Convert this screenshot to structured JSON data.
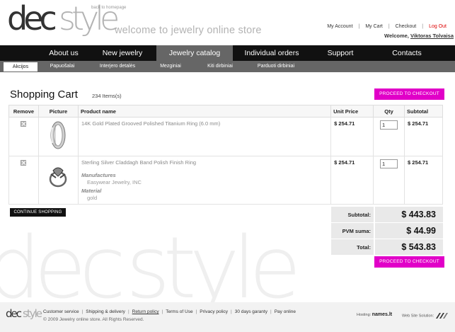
{
  "header": {
    "logo_dec": "dec",
    "logo_style": "style",
    "back_link": "back to homepage",
    "banner": "welcome to jewelry online store",
    "links": {
      "account": "My Account",
      "cart": "My Cart",
      "checkout": "Checkout",
      "logout": "Log Out"
    },
    "welcome_prefix": "Welcome,",
    "username": "Viktoras Tolvaisa"
  },
  "mainnav": [
    {
      "label": "About us",
      "active": false
    },
    {
      "label": "New jewelry",
      "active": false
    },
    {
      "label": "Jewelry catalog",
      "active": true
    },
    {
      "label": "Individual orders",
      "active": false
    },
    {
      "label": "Support",
      "active": false
    },
    {
      "label": "Contacts",
      "active": false
    }
  ],
  "subnav": [
    {
      "label": "Akcijos",
      "active": true
    },
    {
      "label": "Papuošalai",
      "active": false
    },
    {
      "label": "Interjero detalės",
      "active": false
    },
    {
      "label": "Mezginiai",
      "active": false
    },
    {
      "label": "Kiti dirbiniai",
      "active": false
    },
    {
      "label": "Parduoti dirbiniai",
      "active": false
    }
  ],
  "cart": {
    "title": "Shopping Cart",
    "items_count": "234 Items(s)",
    "checkout_label": "PROCEED TO CHECKOUT",
    "continue_label": "CONTINUE SHOPPING",
    "columns": {
      "remove": "Remove",
      "picture": "Picture",
      "product": "Product name",
      "unit_price": "Unit Price",
      "qty": "Qty",
      "subtotal": "Subtotal"
    },
    "items": [
      {
        "name": "14K Gold Plated Grooved Polished Titanium Ring (6.0 mm)",
        "unit_price": "$ 254.71",
        "qty": "1",
        "subtotal": "$ 254.71",
        "attributes": []
      },
      {
        "name": "Sterling Silver Claddagh Band Polish Finish Ring",
        "unit_price": "$ 254.71",
        "qty": "1",
        "subtotal": "$ 254.71",
        "attributes": [
          {
            "title": "Manufactures",
            "value": "Easywear Jewelry, INC"
          },
          {
            "title": "Material",
            "value": "gold"
          }
        ]
      }
    ],
    "totals": {
      "subtotal_label": "Subtotal:",
      "subtotal_value": "$ 443.83",
      "pvm_label": "PVM suma:",
      "pvm_value": "$ 44.99",
      "total_label": "Total:",
      "total_value": "$ 543.83"
    }
  },
  "footer": {
    "logo_dec": "dec",
    "logo_style": "style",
    "links": [
      "Customer service",
      "Shipping & delivery",
      "Return policy",
      "Terms of Use",
      "Privacy policy",
      "30 days garanty",
      "Pay online"
    ],
    "copyright": "© 2009 Jewelry online store. All Rights Reserved.",
    "hosting_label": "Hosting:",
    "hosting_name": "names.lt",
    "solution_label": "Web Site Solution:"
  },
  "colors": {
    "accent": "#e100c8",
    "nav_bg": "#111111",
    "subnav_bg": "#666666",
    "logout": "#dd0000"
  }
}
